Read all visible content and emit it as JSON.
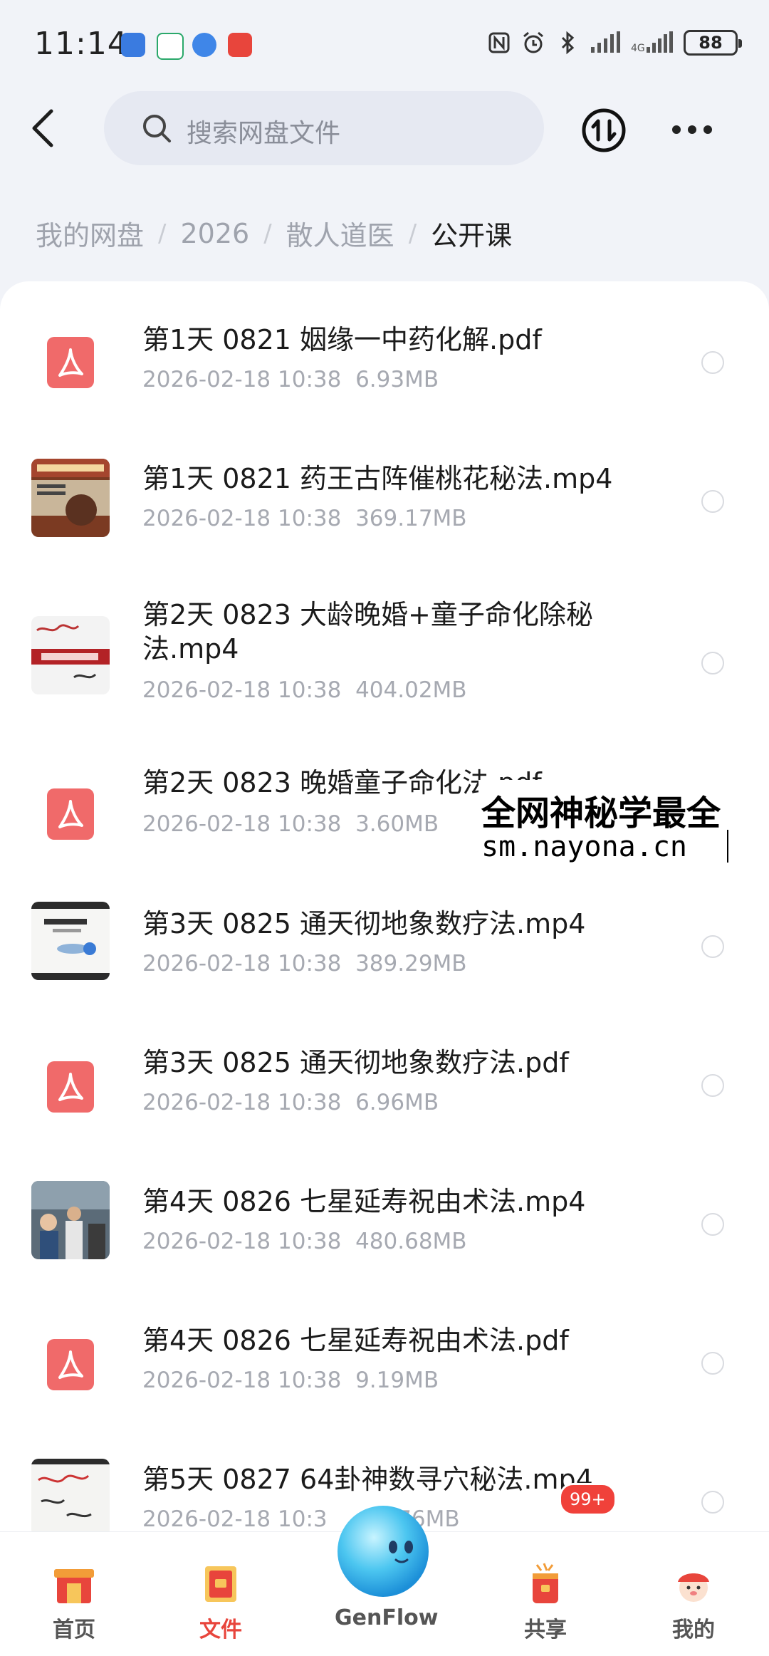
{
  "status": {
    "time": "11:14",
    "battery": "88"
  },
  "search": {
    "placeholder": "搜索网盘文件"
  },
  "breadcrumb": [
    "我的网盘",
    "2026",
    "散人道医",
    "公开课"
  ],
  "files": [
    {
      "name": "第1天  0821  姻缘一中药化解.pdf",
      "date": "2026-02-18  10:38",
      "size": "6.93MB",
      "type": "pdf"
    },
    {
      "name": "第1天  0821  药王古阵催桃花秘法.mp4",
      "date": "2026-02-18  10:38",
      "size": "369.17MB",
      "type": "video"
    },
    {
      "name": "第2天  0823  大龄晚婚+童子命化除秘法.mp4",
      "date": "2026-02-18  10:38",
      "size": "404.02MB",
      "type": "video"
    },
    {
      "name": "第2天  0823  晚婚童子命化法.pdf",
      "date": "2026-02-18  10:38",
      "size": "3.60MB",
      "type": "pdf"
    },
    {
      "name": "第3天  0825  通天彻地象数疗法.mp4",
      "date": "2026-02-18  10:38",
      "size": "389.29MB",
      "type": "video"
    },
    {
      "name": "第3天  0825  通天彻地象数疗法.pdf",
      "date": "2026-02-18  10:38",
      "size": "6.96MB",
      "type": "pdf"
    },
    {
      "name": "第4天  0826  七星延寿祝由术法.mp4",
      "date": "2026-02-18  10:38",
      "size": "480.68MB",
      "type": "video"
    },
    {
      "name": "第4天  0826  七星延寿祝由术法.pdf",
      "date": "2026-02-18  10:38",
      "size": "9.19MB",
      "type": "pdf"
    },
    {
      "name": "第5天  0827  64卦神数寻穴秘法.mp4",
      "date": "2026-02-18  10:3",
      "size": "76MB",
      "type": "video"
    }
  ],
  "watermark": {
    "line1": "全网神秘学最全",
    "line2": "sm.nayona.cn"
  },
  "nav": {
    "items": [
      {
        "label": "首页",
        "icon": "home-gate-icon"
      },
      {
        "label": "文件",
        "icon": "files-scroll-icon",
        "active": true
      },
      {
        "label": "GenFlow",
        "icon": "genflow-ball-icon"
      },
      {
        "label": "共享",
        "icon": "share-gift-icon"
      },
      {
        "label": "我的",
        "icon": "profile-avatar-icon"
      }
    ],
    "share_badge": "99+"
  },
  "colors": {
    "accent": "#e8453c",
    "pdf": "#f06a6a",
    "background": "#f1f3f8"
  }
}
